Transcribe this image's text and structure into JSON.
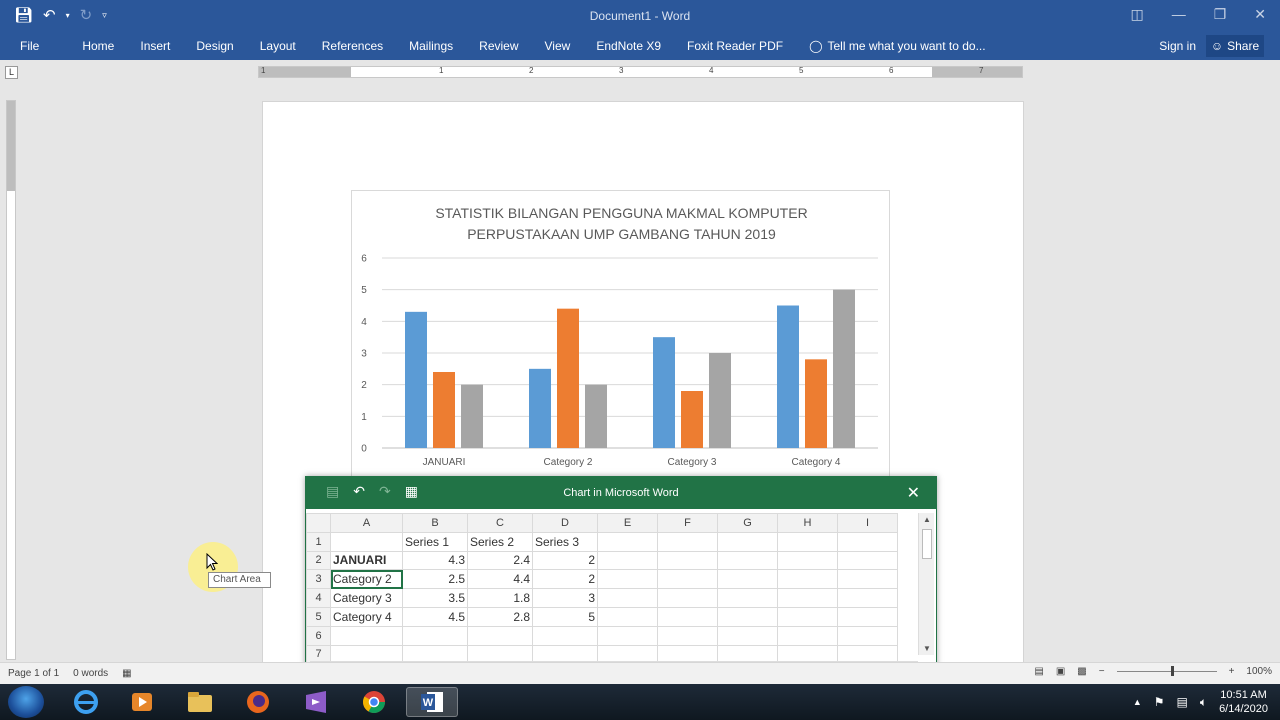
{
  "window": {
    "title": "Document1 - Word"
  },
  "ribbon": {
    "tabs": [
      "File",
      "Home",
      "Insert",
      "Design",
      "Layout",
      "References",
      "Mailings",
      "Review",
      "View",
      "EndNote X9",
      "Foxit Reader PDF"
    ],
    "tell_me": "Tell me what you want to do...",
    "sign_in": "Sign in",
    "share": "Share"
  },
  "ruler": {
    "numbers": [
      "1",
      "1",
      "2",
      "3",
      "4",
      "5",
      "6",
      "7"
    ]
  },
  "chart_data": {
    "type": "bar",
    "title": "STATISTIK BILANGAN PENGGUNA MAKMAL KOMPUTER PERPUSTAKAAN UMP GAMBANG TAHUN 2019",
    "title_lines": [
      "STATISTIK BILANGAN PENGGUNA MAKMAL KOMPUTER",
      "PERPUSTAKAAN UMP GAMBANG TAHUN 2019"
    ],
    "categories": [
      "JANUARI",
      "Category 2",
      "Category 3",
      "Category 4"
    ],
    "series": [
      {
        "name": "Series 1",
        "values": [
          4.3,
          2.5,
          3.5,
          4.5
        ],
        "color": "#5b9bd5"
      },
      {
        "name": "Series 2",
        "values": [
          2.4,
          4.4,
          1.8,
          2.8
        ],
        "color": "#ed7d31"
      },
      {
        "name": "Series 3",
        "values": [
          2,
          2,
          3,
          5
        ],
        "color": "#a5a5a5"
      }
    ],
    "y_ticks": [
      "0",
      "1",
      "2",
      "3",
      "4",
      "5",
      "6"
    ],
    "ylim": [
      0,
      6
    ],
    "grid": true,
    "xlabel": "",
    "ylabel": ""
  },
  "datasheet": {
    "title": "Chart in Microsoft Word",
    "columns": [
      "A",
      "B",
      "C",
      "D",
      "E",
      "F",
      "G",
      "H",
      "I"
    ],
    "row_numbers": [
      "1",
      "2",
      "3",
      "4",
      "5",
      "6",
      "7"
    ],
    "rows": [
      [
        "",
        "Series 1",
        "Series 2",
        "Series 3"
      ],
      [
        "JANUARI",
        "4.3",
        "2.4",
        "2"
      ],
      [
        "Category 2",
        "2.5",
        "4.4",
        "2"
      ],
      [
        "Category 3",
        "3.5",
        "1.8",
        "3"
      ],
      [
        "Category 4",
        "4.5",
        "2.8",
        "5"
      ],
      [
        "",
        "",
        "",
        ""
      ],
      [
        "",
        "",
        "",
        ""
      ]
    ]
  },
  "tooltip": "Chart Area",
  "statusbar": {
    "page": "Page 1 of 1",
    "words": "0 words",
    "zoom": "100%"
  },
  "taskbar": {
    "time": "10:51 AM",
    "date": "6/14/2020"
  },
  "colors": {
    "word_blue": "#2b579a",
    "excel_green": "#217346"
  }
}
